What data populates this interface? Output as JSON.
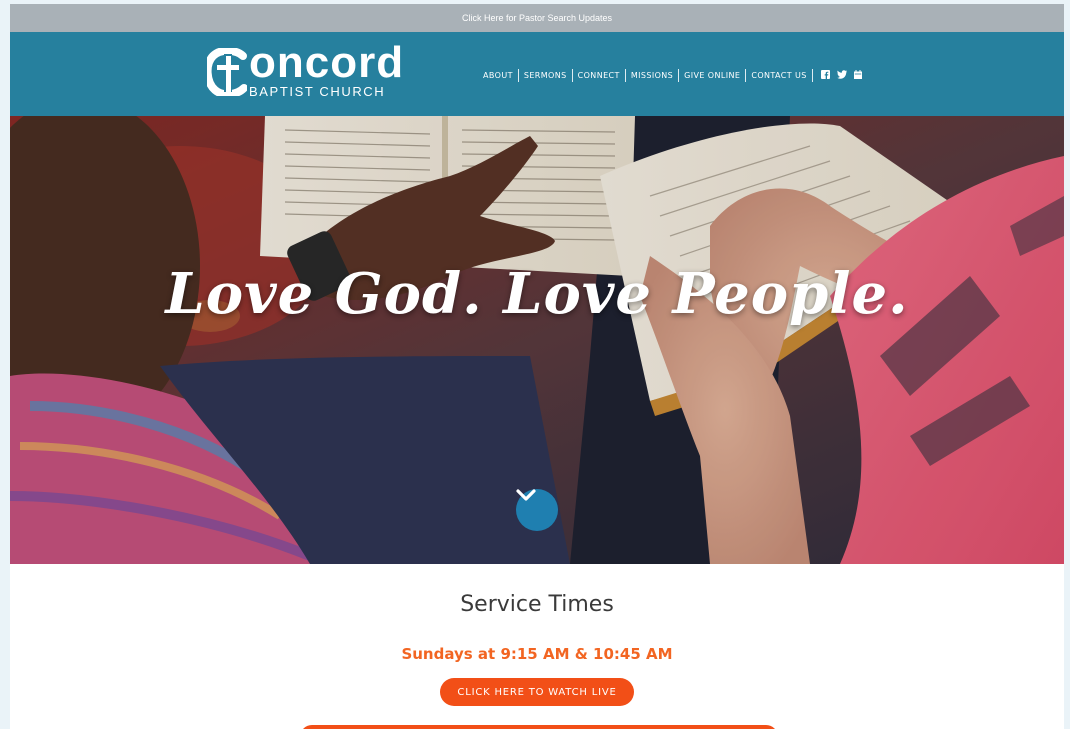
{
  "topbar": {
    "text": "Click Here for Pastor Search Updates"
  },
  "header": {
    "logo_word": "oncord",
    "logo_sub": "BAPTIST CHURCH",
    "logo_icon": "cross-c-mark-icon",
    "nav": [
      {
        "label": "ABOUT"
      },
      {
        "label": "SERMONS"
      },
      {
        "label": "CONNECT"
      },
      {
        "label": "MISSIONS"
      },
      {
        "label": "GIVE ONLINE"
      },
      {
        "label": "CONTACT US"
      }
    ],
    "social_icons": [
      "facebook-icon",
      "twitter-icon",
      "calendar-icon"
    ],
    "background_color": "#26809e"
  },
  "hero": {
    "title": "Love God. Love People.",
    "scroll_icon": "chevron-down-icon"
  },
  "services": {
    "title": "Service Times",
    "time": "Sundays at 9:15 AM & 10:45 AM",
    "watch_button": "CLICK HERE TO WATCH LIVE",
    "accent_color": "#f24f17"
  }
}
